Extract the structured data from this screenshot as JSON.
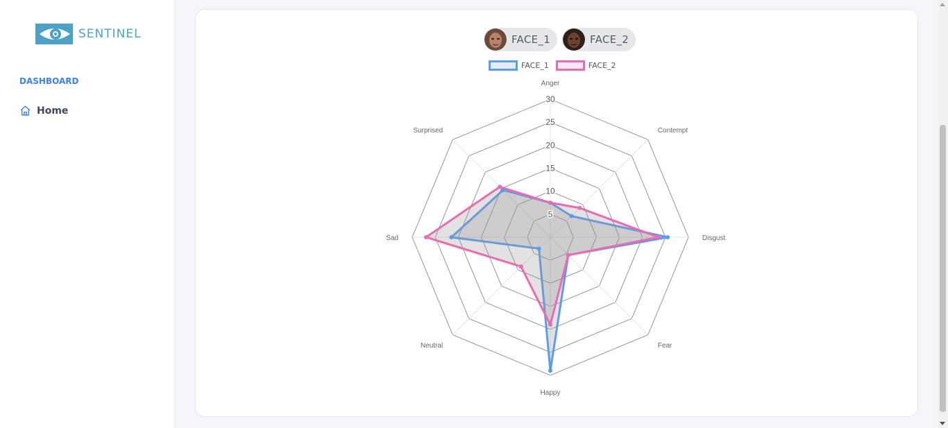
{
  "app": {
    "brand": "SENTINEL"
  },
  "sidebar": {
    "section_label": "DASHBOARD",
    "items": [
      {
        "label": "Home",
        "icon": "home-icon"
      }
    ]
  },
  "faces": [
    {
      "label": "FACE_1",
      "avatar": "face-avatar"
    },
    {
      "label": "FACE_2",
      "avatar": "face-avatar"
    }
  ],
  "colors": {
    "face1": "#5b9cf0",
    "face2": "#e96bb0",
    "accent": "#3d84e6"
  },
  "chart_data": {
    "type": "radar",
    "axes": [
      "Anger",
      "Contempt",
      "Disgust",
      "Fear",
      "Happy",
      "Neutral",
      "Sad",
      "Surprised"
    ],
    "ticks": [
      "5",
      "10",
      "15",
      "20",
      "25",
      "30"
    ],
    "rmin": 0,
    "rmax": 30,
    "legend_position": "top",
    "series": [
      {
        "name": "FACE_1",
        "color": "#5b9cf0",
        "values": [
          7.5,
          6.5,
          25.5,
          5.5,
          29,
          3.5,
          21.5,
          14.5
        ]
      },
      {
        "name": "FACE_2",
        "color": "#e96bb0",
        "values": [
          7.5,
          9,
          23.5,
          5.5,
          19,
          9,
          27,
          15.5
        ]
      }
    ]
  }
}
